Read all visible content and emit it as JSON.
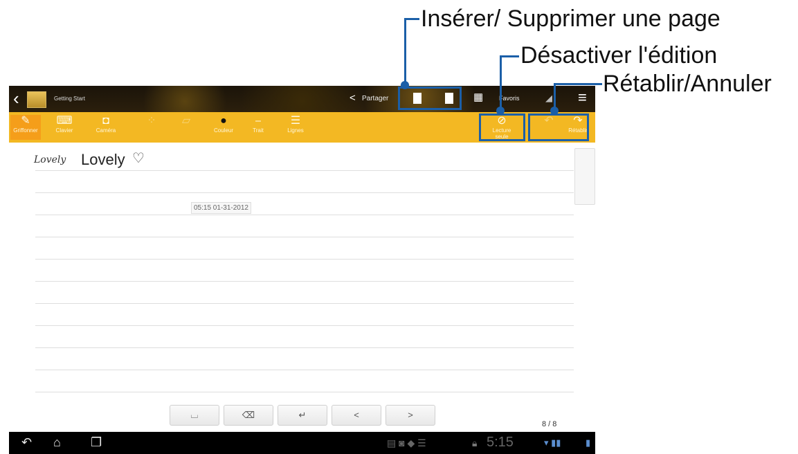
{
  "callouts": {
    "insert_delete_page": "Insérer/ Supprimer une page",
    "disable_editing": "Désactiver l'édition",
    "redo_undo": "Rétablir/Annuler"
  },
  "topbar": {
    "back_glyph": "‹",
    "title": "Getting Start",
    "share_label": "Partager",
    "favorites_label": "Favoris",
    "menu_glyph": "≡"
  },
  "toolbar": {
    "scribble": "Griffonner",
    "keyboard": "Clavier",
    "camera": "Caméra",
    "color": "Couleur",
    "text": "Trait",
    "lines": "Lignes",
    "read_only": "Lecture seule",
    "redo": "Rétablir"
  },
  "note": {
    "handwritten": "Lovely",
    "typed": "Lovely",
    "timestamp": "05:15 01-31-2012"
  },
  "keys": {
    "space": "⌴",
    "backspace": "⌫",
    "enter": "↵",
    "prev": "<",
    "next": ">"
  },
  "pager": "8 / 8",
  "status": {
    "time": "5:15"
  },
  "colors": {
    "toolbar": "#f3b823",
    "callout": "#1b5fa8"
  }
}
